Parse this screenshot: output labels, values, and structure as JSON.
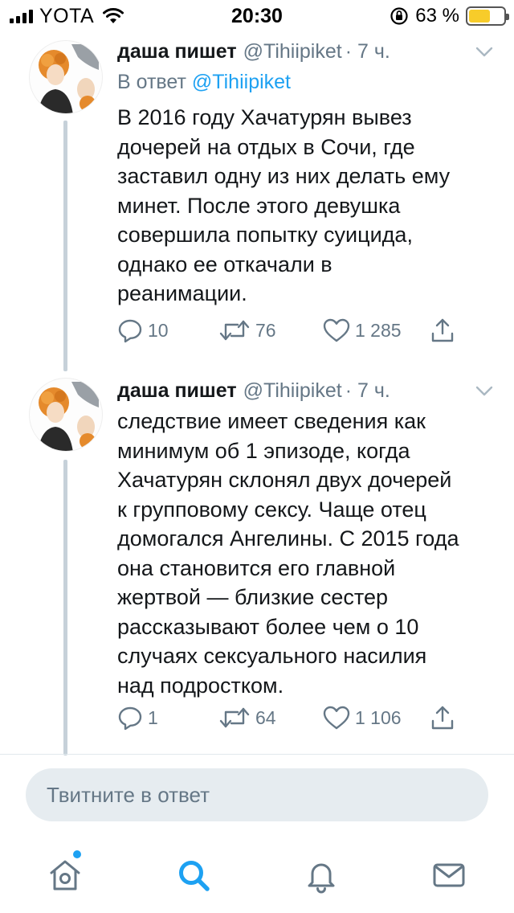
{
  "status_bar": {
    "carrier": "YOTA",
    "time": "20:30",
    "battery_percent": "63 %",
    "battery_level": 0.63,
    "icons": [
      "signal-icon",
      "wifi-icon",
      "rotation-lock-icon",
      "battery-icon"
    ]
  },
  "tweets": [
    {
      "name": "даша пишет",
      "handle": "@Tihiipiket",
      "time": "· 7 ч.",
      "reply_prefix": "В ответ ",
      "reply_handle": "@Tihiipiket",
      "text": "В 2016 году Хачатурян вывез\nдочерей на отдых в Сочи, где\nзаставил одну из них делать ему\nминет. После этого девушка\nсовершила попытку суицида,\nоднако ее откачали в\nреанимации.",
      "replies": "10",
      "retweets": "76",
      "likes": "1 285"
    },
    {
      "name": "даша пишет",
      "handle": "@Tihiipiket",
      "time": "· 7 ч.",
      "text": "следствие имеет сведения как\nминимум об 1 эпизоде, когда\nХачатурян склонял двух дочерей\nк групповому сексу. Чаще отец\nдомогался Ангелины. С 2015 года\nона становится его главной\nжертвой — близкие сестер\nрассказывают более чем о 10\nслучаях сексуального насилия\nнад подростком.",
      "replies": "1",
      "retweets": "64",
      "likes": "1 106"
    }
  ],
  "reply_box": {
    "placeholder": "Твитните в ответ"
  },
  "tab_bar": {
    "items": [
      "home-icon",
      "search-icon",
      "notifications-icon",
      "messages-icon"
    ],
    "active": "search-icon"
  },
  "colors": {
    "accent": "#1da1f2",
    "secondary_text": "#657786",
    "thread_line": "#c6d1d9",
    "battery": "#f7cc2a"
  }
}
